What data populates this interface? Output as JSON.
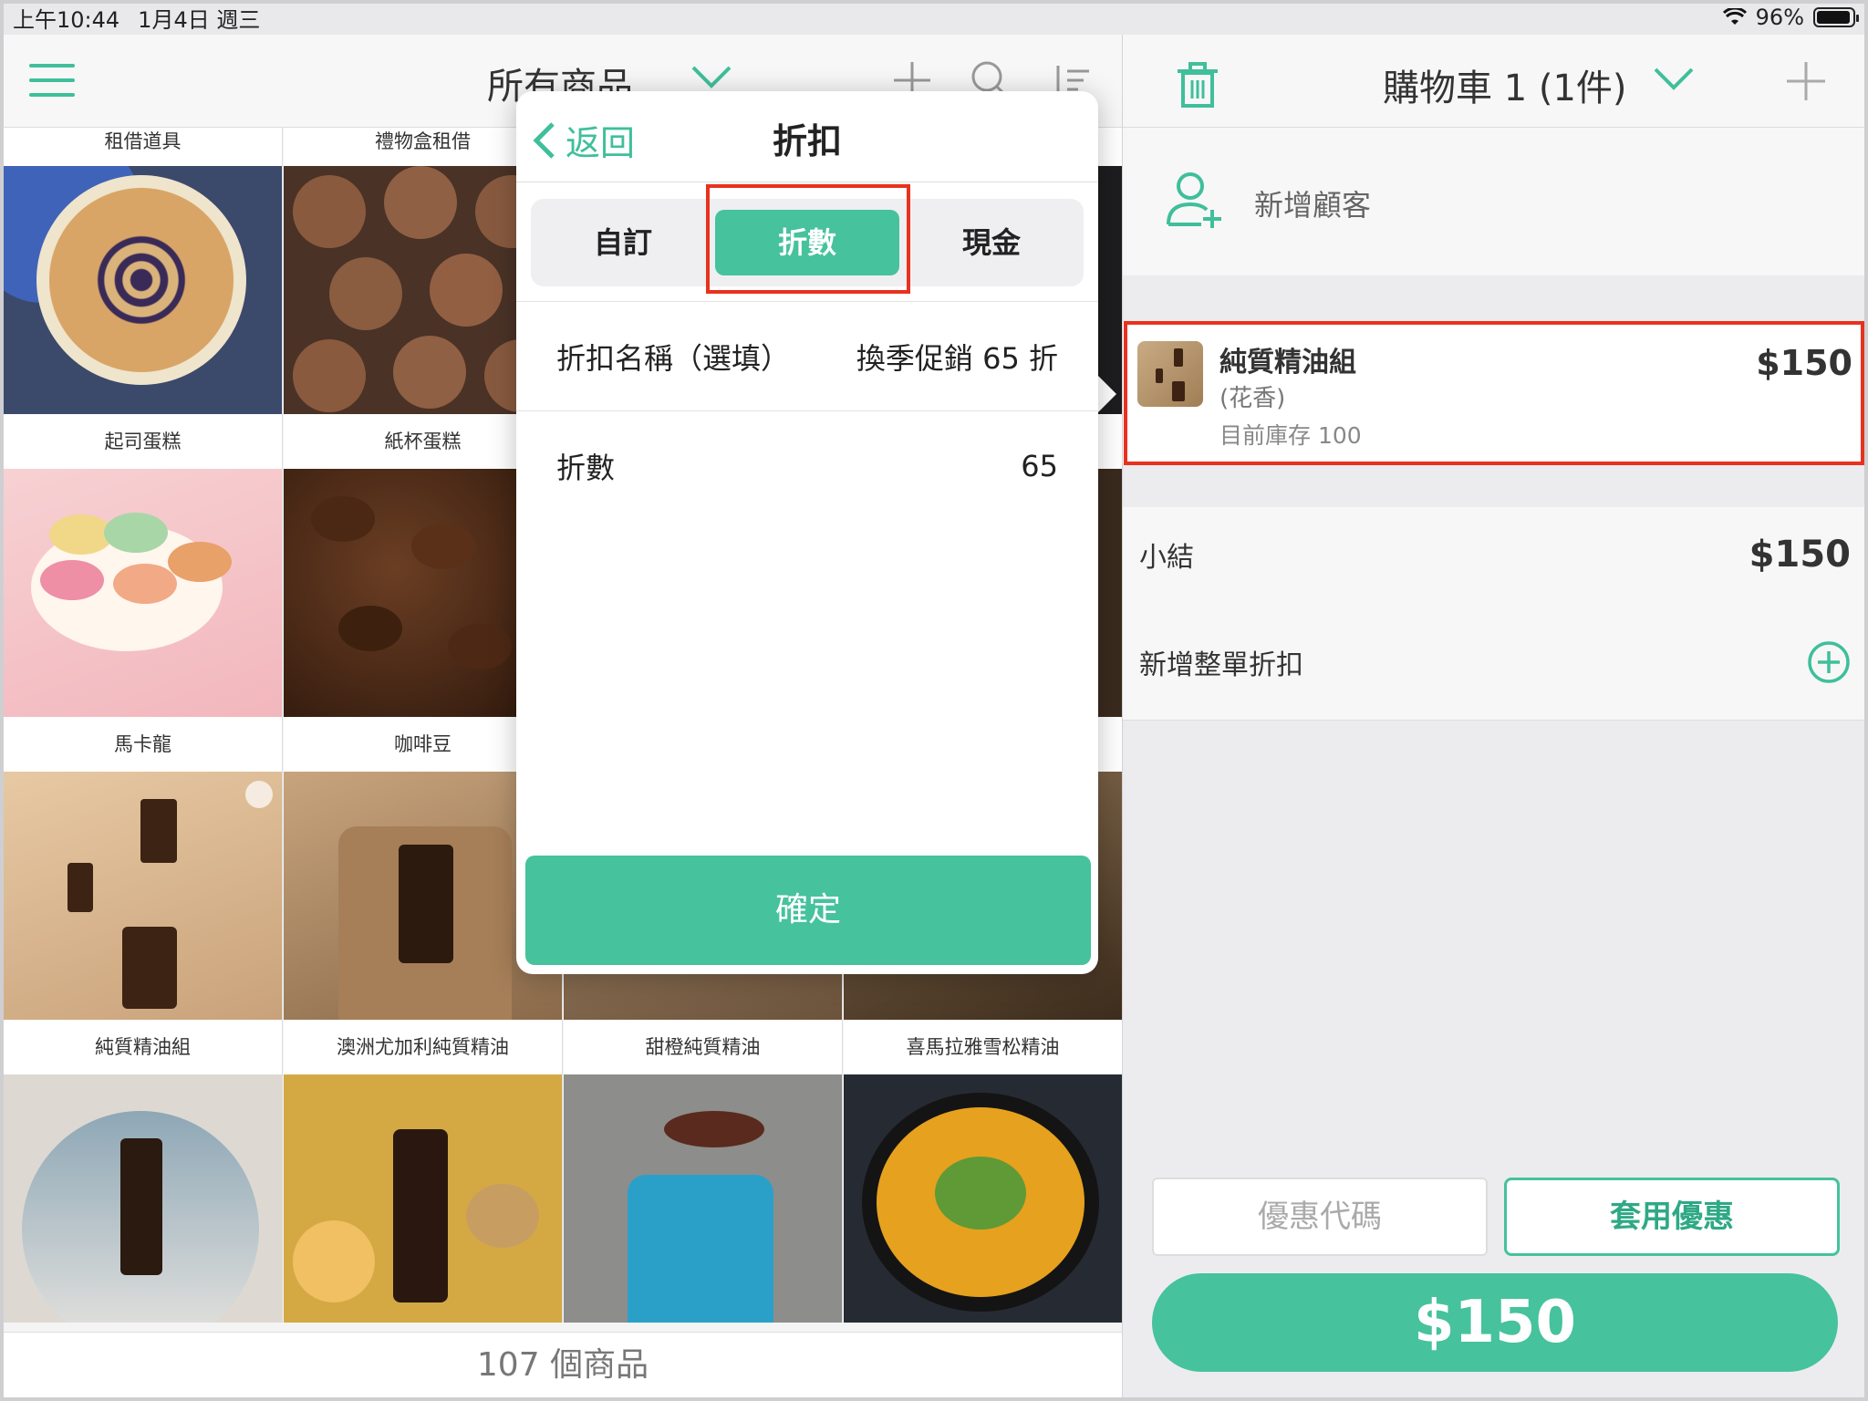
{
  "status": {
    "time": "上午10:44",
    "date": "1月4日 週三",
    "battery": "96%"
  },
  "left": {
    "title": "所有商品",
    "top_labels": [
      "租借道具",
      "禮物盒租借"
    ],
    "row1_labels": [
      "起司蛋糕",
      "紙杯蛋糕"
    ],
    "row2_labels": [
      "馬卡龍",
      "咖啡豆"
    ],
    "row3_labels": [
      "純質精油組",
      "澳洲尤加利純質精油",
      "甜橙純質精油",
      "喜馬拉雅雪松精油"
    ],
    "footer": "107 個商品"
  },
  "popover": {
    "back": "返回",
    "title": "折扣",
    "tabs": [
      "自訂",
      "折數",
      "現金"
    ],
    "active_tab": "折數",
    "name_label": "折扣名稱（選填）",
    "name_value": "換季促銷 65 折",
    "rate_label": "折數",
    "rate_value": "65",
    "confirm": "確定"
  },
  "cart": {
    "title": "購物車 1 (1件)",
    "add_customer": "新增顧客",
    "item": {
      "name": "純質精油組",
      "variant": "(花香)",
      "stock": "目前庫存 100",
      "price": "$150"
    },
    "subtotal_label": "小結",
    "subtotal": "$150",
    "order_discount": "新增整單折扣",
    "coupon_placeholder": "優惠代碼",
    "apply": "套用優惠",
    "total": "$150"
  },
  "colors": {
    "accent": "#46c29c",
    "highlight": "#e8321e"
  }
}
